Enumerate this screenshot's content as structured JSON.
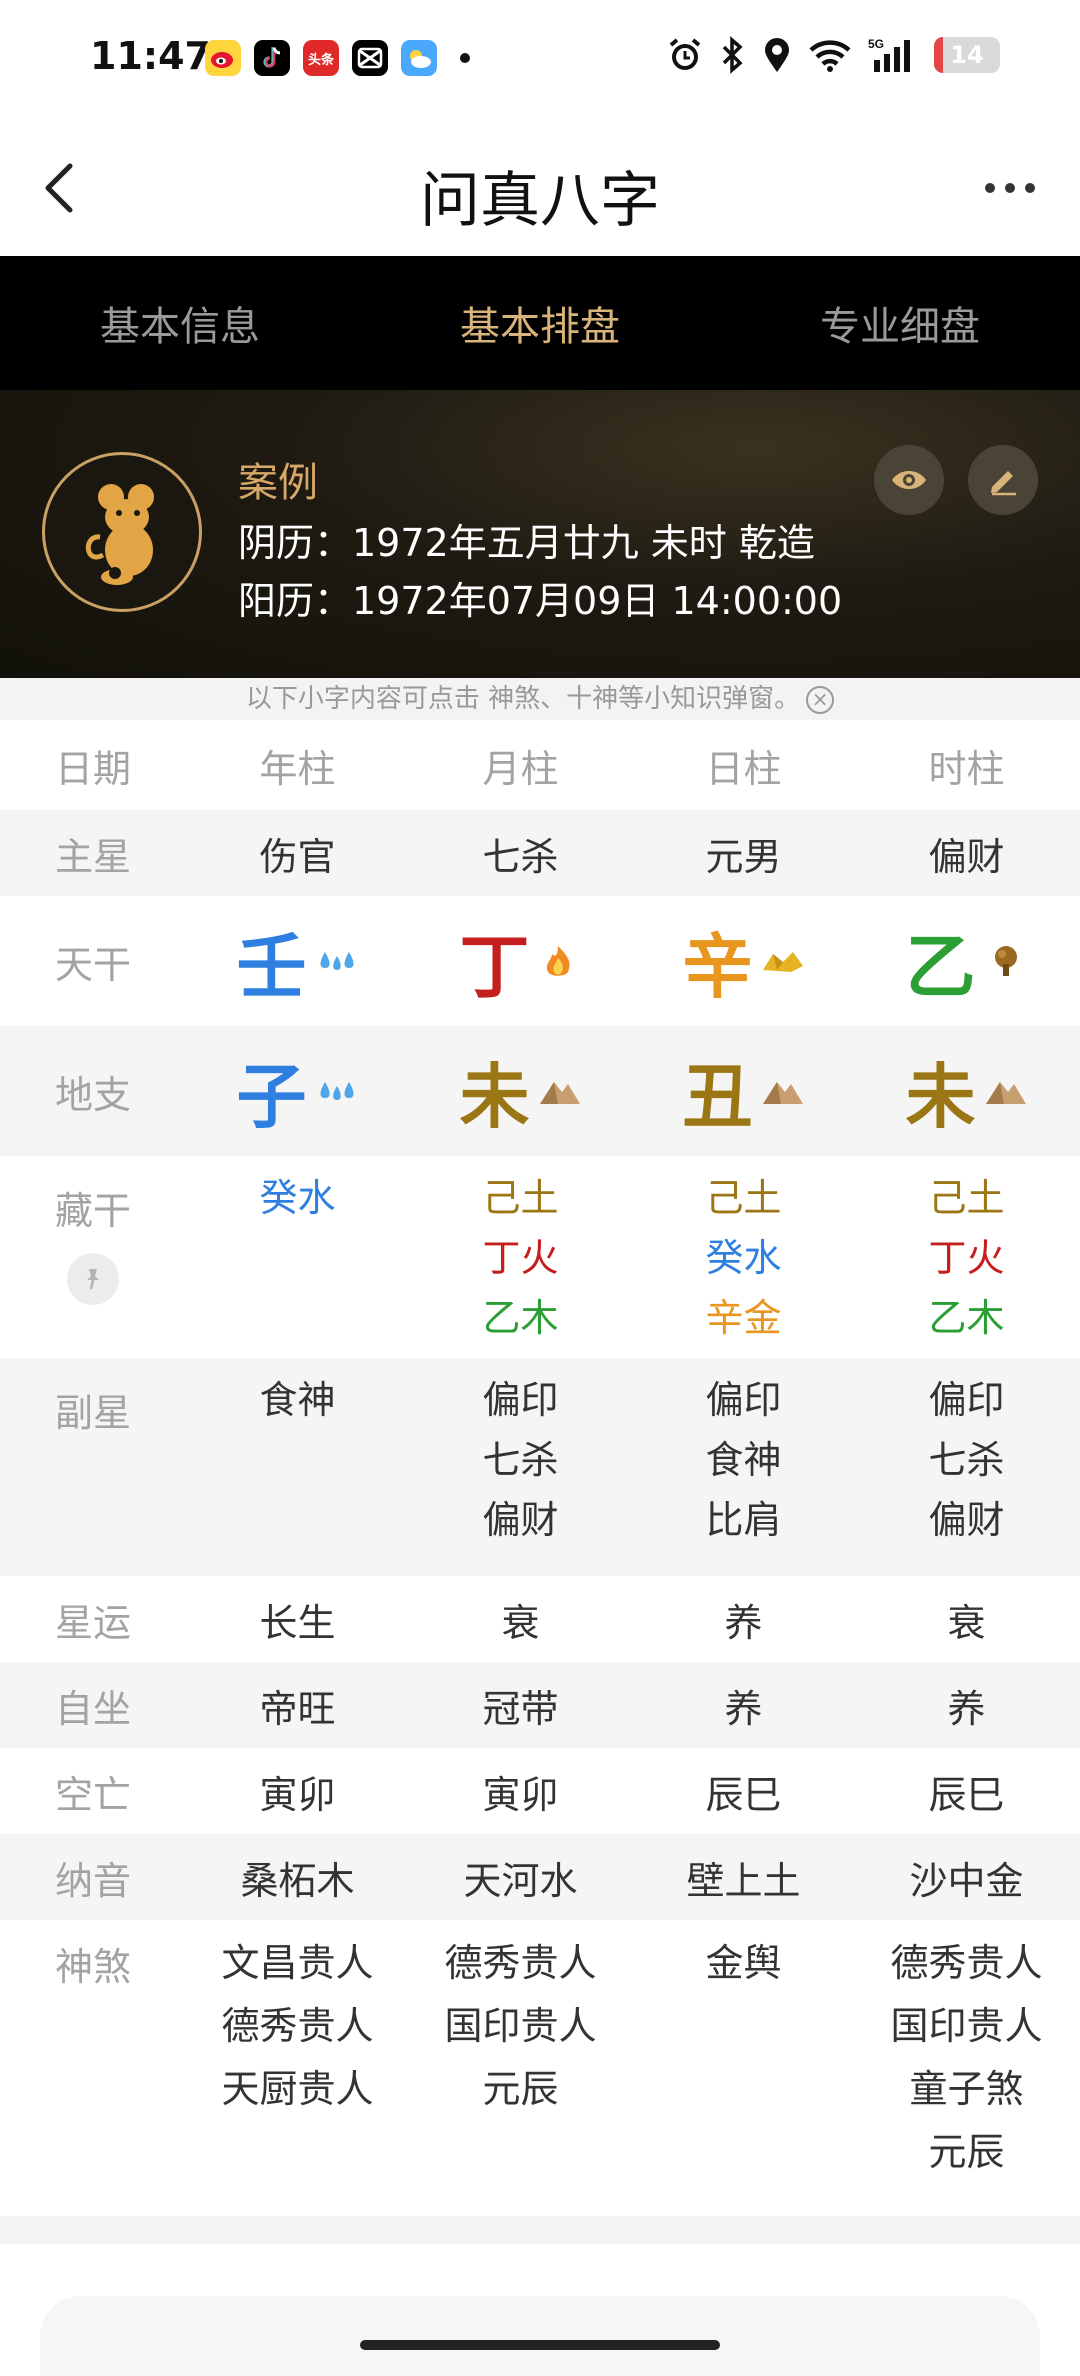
{
  "status": {
    "time": "11:47",
    "apps": [
      "weibo",
      "tiktok",
      "头条",
      "capcut",
      "weather"
    ],
    "signal": "5G",
    "battery": "14",
    "battery_level": 0.14
  },
  "nav": {
    "title": "问真八字"
  },
  "tabs": [
    {
      "label": "基本信息",
      "active": false
    },
    {
      "label": "基本排盘",
      "active": true
    },
    {
      "label": "专业细盘",
      "active": false
    }
  ],
  "profile": {
    "name": "案例",
    "lunar": "阴历：1972年五月廿九 未时 乾造",
    "solar": "阳历：1972年07月09日 14:00:00"
  },
  "tip": "以下小字内容可点击 神煞、十神等小知识弹窗。",
  "table": {
    "header": [
      "日期",
      "年柱",
      "月柱",
      "日柱",
      "时柱"
    ],
    "zhuxing": {
      "label": "主星",
      "values": [
        "伤官",
        "七杀",
        "元男",
        "偏财"
      ]
    },
    "tiangan": {
      "label": "天干",
      "values": [
        "壬",
        "丁",
        "辛",
        "乙"
      ]
    },
    "dizhi": {
      "label": "地支",
      "values": [
        "子",
        "未",
        "丑",
        "未"
      ]
    },
    "canggan": {
      "label": "藏干",
      "values": [
        [
          "癸水"
        ],
        [
          "己土",
          "丁火",
          "乙木"
        ],
        [
          "己土",
          "癸水",
          "辛金"
        ],
        [
          "己土",
          "丁火",
          "乙木"
        ]
      ]
    },
    "fuxing": {
      "label": "副星",
      "values": [
        [
          "食神"
        ],
        [
          "偏印",
          "七杀",
          "偏财"
        ],
        [
          "偏印",
          "食神",
          "比肩"
        ],
        [
          "偏印",
          "七杀",
          "偏财"
        ]
      ]
    },
    "xingyun": {
      "label": "星运",
      "values": [
        "长生",
        "衰",
        "养",
        "衰"
      ]
    },
    "zizuo": {
      "label": "自坐",
      "values": [
        "帝旺",
        "冠带",
        "养",
        "养"
      ]
    },
    "kongwang": {
      "label": "空亡",
      "values": [
        "寅卯",
        "寅卯",
        "辰巳",
        "辰巳"
      ]
    },
    "nayin": {
      "label": "纳音",
      "values": [
        "桑柘木",
        "天河水",
        "壁上土",
        "沙中金"
      ]
    },
    "shensha": {
      "label": "神煞",
      "values": [
        [
          "文昌贵人",
          "德秀贵人",
          "天厨贵人"
        ],
        [
          "德秀贵人",
          "国印贵人",
          "元辰"
        ],
        [
          "金舆"
        ],
        [
          "德秀贵人",
          "国印贵人",
          "童子煞",
          "元辰"
        ]
      ]
    }
  },
  "colors": {
    "water": "#2f7fe0",
    "fire": "#c41e1e",
    "earth": "#9a7614",
    "metal": "#e8961e",
    "wood": "#2b9e34",
    "gold": "#c19a5b",
    "tab_active": "#d9b47a"
  }
}
